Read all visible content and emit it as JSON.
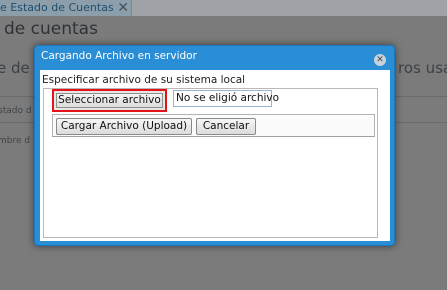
{
  "background": {
    "tab_label": "e Estado de Cuentas",
    "tab_close": "✕",
    "page_title": "de cuentas",
    "left_fragment": "e de cu",
    "right_fragment": "ros usa",
    "row1_fragment": "stado d",
    "row2_fragment": "mbre d"
  },
  "modal": {
    "title": "Cargando Archivo en servidor",
    "close": "✕",
    "field_label": "Especificar archivo de su sistema local",
    "select_button": "Seleccionar archivo",
    "file_status": "No se eligió archivo",
    "upload_button": "Cargar Archivo (Upload)",
    "cancel_button": "Cancelar"
  },
  "colors": {
    "modal_accent": "#2a8ed6",
    "highlight": "#e2141a",
    "overlay": "#7b7b7b"
  }
}
